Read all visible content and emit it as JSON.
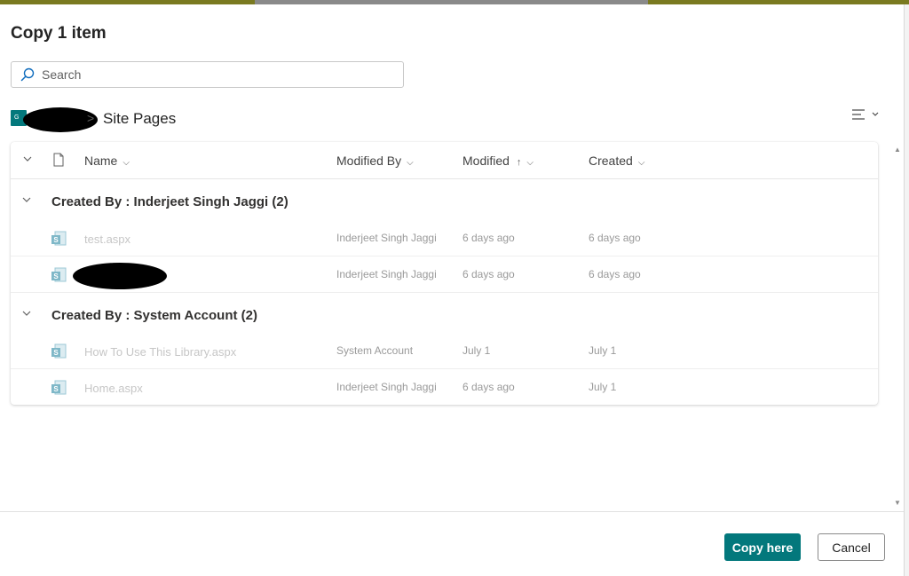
{
  "dialog": {
    "title": "Copy 1 item",
    "search": {
      "placeholder": "Search",
      "value": ""
    }
  },
  "breadcrumb": {
    "site_badge": "G",
    "separator": ">",
    "current": "Site Pages"
  },
  "list": {
    "columns": {
      "name": "Name",
      "modified_by": "Modified By",
      "modified": "Modified",
      "modified_sort": "↑",
      "created": "Created"
    },
    "groups": [
      {
        "label": "Created By : Inderjeet Singh Jaggi (2)",
        "rows": [
          {
            "name": "test.aspx",
            "modified_by": "Inderjeet Singh Jaggi",
            "modified": "6 days ago",
            "created": "6 days ago"
          },
          {
            "name": "",
            "modified_by": "Inderjeet Singh Jaggi",
            "modified": "6 days ago",
            "created": "6 days ago"
          }
        ]
      },
      {
        "label": "Created By : System Account (2)",
        "rows": [
          {
            "name": "How To Use This Library.aspx",
            "modified_by": "System Account",
            "modified": "July 1",
            "created": "July 1"
          },
          {
            "name": "Home.aspx",
            "modified_by": "Inderjeet Singh Jaggi",
            "modified": "6 days ago",
            "created": "July 1"
          }
        ]
      }
    ]
  },
  "footer": {
    "copy_label": "Copy here",
    "cancel_label": "Cancel"
  },
  "colors": {
    "accent": "#03787c",
    "page_icon": "#7fb8c8"
  },
  "icons": {
    "search": "search-icon",
    "page": "sharepoint-page-icon",
    "file": "document-icon",
    "view": "view-options-icon"
  }
}
